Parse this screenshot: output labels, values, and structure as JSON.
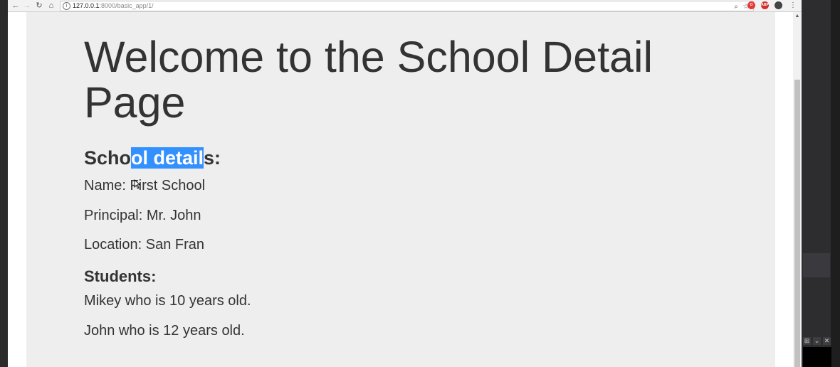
{
  "browser": {
    "url_host": "127.0.0.1",
    "url_rest": ":8000/basic_app/1/",
    "nav_icons": [
      "back-icon",
      "forward-icon",
      "reload-icon",
      "home-icon"
    ],
    "toolbar_icons": [
      "zoom-icon",
      "star-icon",
      "opera-icon",
      "adblock-icon",
      "extension-icon",
      "menu-icon"
    ],
    "adblock_label": "ABP"
  },
  "page": {
    "title_line1": "Welcome to the School Detail",
    "title_line2": "Page",
    "subhead_pre": "Scho",
    "subhead_sel": "ol detail",
    "subhead_post": "s:",
    "name_line": "Name: First School",
    "principal_line": "Principal: Mr. John",
    "location_line": "Location: San Fran",
    "students_heading": "Students:",
    "students": [
      "Mikey who is 10 years old.",
      "John who is 12 years old."
    ]
  },
  "colors": {
    "selection": "#3390ff",
    "page_background": "#eeeeee",
    "text": "#333333"
  }
}
